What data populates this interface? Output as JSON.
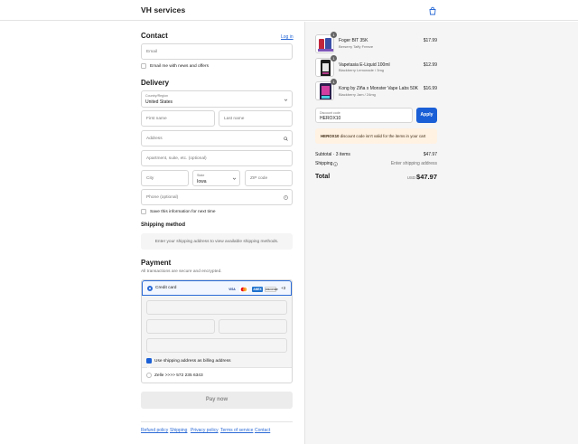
{
  "header": {
    "brand": "VH services",
    "cart_icon": "shopping-bag-icon"
  },
  "contact": {
    "title": "Contact",
    "login_link": "Log in",
    "email_placeholder": "Email",
    "news_label": "Email me with news and offers"
  },
  "delivery": {
    "title": "Delivery",
    "country_label": "Country/Region",
    "country_value": "United States",
    "first_name_placeholder": "First name",
    "last_name_placeholder": "Last name",
    "address_placeholder": "Address",
    "apartment_placeholder": "Apartment, suite, etc. (optional)",
    "city_placeholder": "City",
    "state_label": "State",
    "state_value": "Iowa",
    "zip_placeholder": "ZIP code",
    "phone_placeholder": "Phone (optional)",
    "save_info_label": "Save this information for next time"
  },
  "shipping": {
    "title": "Shipping method",
    "note": "Enter your shipping address to view available shipping methods."
  },
  "payment": {
    "title": "Payment",
    "subtitle": "All transactions are secure and encrypted.",
    "credit_card_label": "Credit card",
    "card_logos": [
      "VISA",
      "MC",
      "AMEX",
      "DISCOVER"
    ],
    "more_cards": "+3",
    "billing_label": "Use shipping address as billing address",
    "zelle_label": "Zelle >>>> 572 235 6343",
    "pay_button": "Pay now"
  },
  "footer": {
    "links": [
      "Refund policy",
      "Shipping",
      "Privacy policy",
      "Terms of service",
      "Contact"
    ]
  },
  "cart": {
    "items": [
      {
        "name": "Foger BIT 35K",
        "variant": "Berserry Taffy Freeze",
        "price": "$17.99",
        "qty": "1"
      },
      {
        "name": "Vapetasia E-Liquid 100ml",
        "variant": "Blackberry Lemonade / 3mg",
        "price": "$12.99",
        "qty": "1"
      },
      {
        "name": "Kong by Ziña x Monster Vape Labs 50K",
        "variant": "Blackberry Jam / 24mg",
        "price": "$16.99",
        "qty": "1"
      }
    ],
    "discount_label": "Discount code",
    "discount_value": "HEROX10",
    "apply_button": "Apply",
    "warning_code": "HEROX10",
    "warning_text": " discount code isn't valid for the items in your cart",
    "subtotal_label": "Subtotal · 3 items",
    "subtotal_value": "$47.97",
    "shipping_label": "Shipping",
    "shipping_value": "Enter shipping address",
    "total_label": "Total",
    "currency": "USD",
    "total_value": "$47.97"
  },
  "colors": {
    "accent": "#1a5fd6",
    "warning_bg": "#fff2e3",
    "panel_bg": "#f5f5f5"
  }
}
